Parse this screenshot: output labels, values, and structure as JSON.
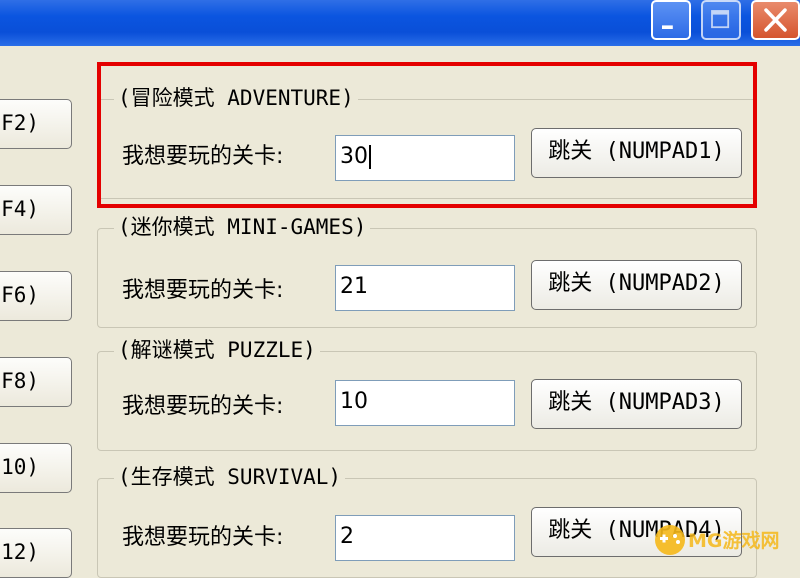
{
  "sidebar": {
    "buttons": [
      {
        "label": "F2)"
      },
      {
        "label": "F4)"
      },
      {
        "label": "F6)"
      },
      {
        "label": "F8)"
      },
      {
        "label": "10)"
      },
      {
        "label": "12)"
      }
    ]
  },
  "groups": [
    {
      "title": "(冒险模式 ADVENTURE)",
      "label": "我想要玩的关卡:",
      "value": "30",
      "button": "跳关 (NUMPAD1)"
    },
    {
      "title": "(迷你模式 MINI-GAMES)",
      "label": "我想要玩的关卡:",
      "value": "21",
      "button": "跳关 (NUMPAD2)"
    },
    {
      "title": "(解谜模式 PUZZLE)",
      "label": "我想要玩的关卡:",
      "value": "10",
      "button": "跳关 (NUMPAD3)"
    },
    {
      "title": "(生存模式 SURVIVAL)",
      "label": "我想要玩的关卡:",
      "value": "2",
      "button": "跳关 (NUMPAD4)"
    }
  ],
  "watermark": {
    "text": "MG游戏网"
  },
  "icons": {
    "minimize": "minimize-icon",
    "maximize": "maximize-icon",
    "close": "close-icon"
  },
  "colors": {
    "titlebar": "#0b55e0",
    "highlight": "#e40000",
    "window_bg": "#ece9d8"
  }
}
